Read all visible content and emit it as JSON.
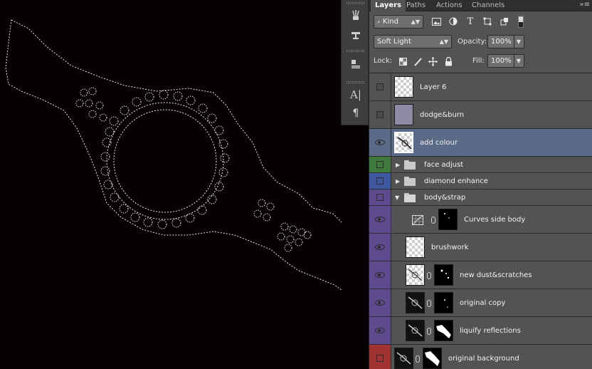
{
  "panel": {
    "tabs": [
      {
        "label": "Layers",
        "active": true
      },
      {
        "label": "Paths",
        "active": false
      },
      {
        "label": "Actions",
        "active": false
      },
      {
        "label": "Channels",
        "active": false
      }
    ],
    "menu_icon": "panel-menu-icon",
    "filter": {
      "kind_label": "Kind",
      "search_icon": "search-icon"
    },
    "blend_mode": "Soft Light",
    "opacity_label": "Opacity:",
    "opacity_value": "100%",
    "lock_label": "Lock:",
    "fill_label": "Fill:",
    "fill_value": "100%"
  },
  "colors": {
    "selected": "#5b6a86",
    "green": "#3f7a3c",
    "blue": "#3f56a0",
    "purple": "#5e4a8f",
    "red": "#a03232"
  },
  "layers": [
    {
      "name": "Layer 6",
      "visible": false,
      "type": "pixel"
    },
    {
      "name": "dodge&burn",
      "visible": false,
      "type": "pixel"
    },
    {
      "name": "add colour",
      "visible": true,
      "selected": true,
      "type": "pixel"
    },
    {
      "name": "face adjust",
      "type": "group",
      "expanded": false,
      "color": "green"
    },
    {
      "name": "diamond enhance",
      "type": "group",
      "expanded": false,
      "color": "blue"
    },
    {
      "name": "body&strap",
      "type": "group",
      "expanded": true,
      "color": "purple"
    },
    {
      "name": "Curves side body",
      "visible": true,
      "type": "adjustment",
      "color": "purple"
    },
    {
      "name": "brushwork",
      "visible": true,
      "type": "pixel",
      "color": "purple"
    },
    {
      "name": "new dust&scratches",
      "visible": true,
      "type": "masked",
      "color": "purple"
    },
    {
      "name": "original copy",
      "visible": true,
      "type": "masked",
      "color": "purple"
    },
    {
      "name": "liquify reflections",
      "visible": true,
      "type": "masked",
      "color": "purple"
    },
    {
      "name": "original background",
      "visible": false,
      "type": "masked",
      "color": "red"
    }
  ]
}
